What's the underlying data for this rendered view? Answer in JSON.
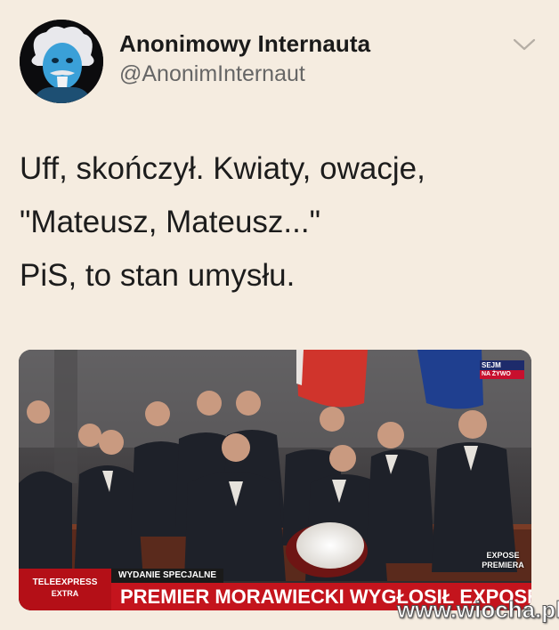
{
  "tweet": {
    "author": {
      "display_name": "Anonimowy Internauta",
      "handle": "@AnonimInternaut",
      "avatar_icon": "einstein-tongue-avatar"
    },
    "menu_icon": "chevron-down-icon",
    "text_lines": [
      "Uff, skończył. Kwiaty, owacje,",
      "\"Mateusz, Mateusz...\"",
      "PiS, to stan umysłu."
    ]
  },
  "media": {
    "channel_badge": {
      "name": "SEJM",
      "status": "NA ŻYWO"
    },
    "corner_badge": {
      "line1": "EXPOSE",
      "line2": "PREMIERA"
    },
    "lower_third": {
      "program_line1": "TELEEXPRESS",
      "program_line2": "EXTRA",
      "tag": "WYDANIE SPECJALNE",
      "headline": "PREMIER MORAWIECKI WYGŁOSIŁ EXPOSE"
    }
  },
  "watermark": "www.wiocha.pl",
  "colors": {
    "background": "#f5ece0",
    "display_name": "#1a1a1a",
    "handle": "#666666",
    "news_red": "#c4141d",
    "flag_red": "#d0342c",
    "eu_blue": "#1f3f8f"
  }
}
